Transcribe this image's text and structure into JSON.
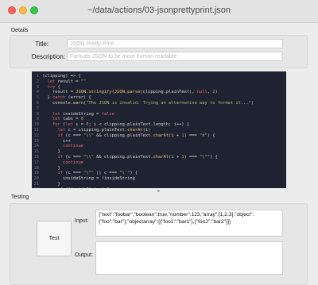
{
  "window": {
    "title": "~/data/actions/03-jsonprettyprint.json"
  },
  "details": {
    "section_label": "Details",
    "title_label": "Title:",
    "title_placeholder": "JSON Pretty Print",
    "description_label": "Description:",
    "description_placeholder": "Formats JSON to be more human readable"
  },
  "editor": {
    "lines": [
      {
        "num": "1",
        "parts": [
          [
            "txt",
            "(clipping) => {"
          ]
        ]
      },
      {
        "num": "2",
        "parts": [
          [
            "txt",
            "  "
          ],
          [
            "kw",
            "let"
          ],
          [
            "txt",
            " result = "
          ],
          [
            "str",
            "\"\""
          ]
        ]
      },
      {
        "num": "3",
        "parts": [
          [
            "txt",
            "  "
          ],
          [
            "kw",
            "try"
          ],
          [
            "txt",
            " {"
          ]
        ]
      },
      {
        "num": "4",
        "parts": [
          [
            "txt",
            "    result = "
          ],
          [
            "fn",
            "JSON"
          ],
          [
            "txt",
            "."
          ],
          [
            "fn",
            "stringify"
          ],
          [
            "txt",
            "("
          ],
          [
            "fn",
            "JSON"
          ],
          [
            "txt",
            "."
          ],
          [
            "fn",
            "parse"
          ],
          [
            "txt",
            "(clipping.plainText), "
          ],
          [
            "kw",
            "null"
          ],
          [
            "txt",
            ", "
          ],
          [
            "num",
            "2"
          ],
          [
            "txt",
            ")"
          ]
        ]
      },
      {
        "num": "5",
        "parts": [
          [
            "txt",
            "  } "
          ],
          [
            "kw",
            "catch"
          ],
          [
            "txt",
            " (error) {"
          ]
        ]
      },
      {
        "num": "6",
        "parts": [
          [
            "txt",
            "    console."
          ],
          [
            "fn",
            "warn"
          ],
          [
            "txt",
            "("
          ],
          [
            "str",
            "\"The JSON is invalid. Trying an alternative way to format it...\""
          ],
          [
            "txt",
            ")"
          ]
        ]
      },
      {
        "num": "7",
        "parts": [
          [
            "txt",
            ""
          ]
        ]
      },
      {
        "num": "8",
        "parts": [
          [
            "txt",
            "    "
          ],
          [
            "kw",
            "let"
          ],
          [
            "txt",
            " insideString = "
          ],
          [
            "kw",
            "false"
          ]
        ]
      },
      {
        "num": "9",
        "parts": [
          [
            "txt",
            "    "
          ],
          [
            "kw",
            "let"
          ],
          [
            "txt",
            " tabs = "
          ],
          [
            "num",
            "0"
          ]
        ]
      },
      {
        "num": "10",
        "parts": [
          [
            "txt",
            "    "
          ],
          [
            "kw",
            "for"
          ],
          [
            "txt",
            " ("
          ],
          [
            "kw",
            "let"
          ],
          [
            "txt",
            " i = "
          ],
          [
            "num",
            "0"
          ],
          [
            "txt",
            "; i < clipping.plainText.length; i++) {"
          ]
        ]
      },
      {
        "num": "11",
        "parts": [
          [
            "txt",
            "      "
          ],
          [
            "kw",
            "let"
          ],
          [
            "txt",
            " c = clipping.plainText."
          ],
          [
            "fn",
            "charAt"
          ],
          [
            "txt",
            "(i)"
          ]
        ]
      },
      {
        "num": "12",
        "parts": [
          [
            "txt",
            "      "
          ],
          [
            "kw",
            "if"
          ],
          [
            "txt",
            " (c === "
          ],
          [
            "str",
            "\"\\\\\""
          ],
          [
            "txt",
            " && clipping.plainText."
          ],
          [
            "fn",
            "charAt"
          ],
          [
            "txt",
            "(i + "
          ],
          [
            "num",
            "1"
          ],
          [
            "txt",
            ") === "
          ],
          [
            "str",
            "\"n\""
          ],
          [
            "txt",
            ") {"
          ]
        ]
      },
      {
        "num": "13",
        "parts": [
          [
            "txt",
            "        i++"
          ]
        ]
      },
      {
        "num": "14",
        "parts": [
          [
            "txt",
            "        "
          ],
          [
            "kw",
            "continue"
          ]
        ]
      },
      {
        "num": "15",
        "parts": [
          [
            "txt",
            "      }"
          ]
        ]
      },
      {
        "num": "16",
        "parts": [
          [
            "txt",
            "      "
          ],
          [
            "kw",
            "if"
          ],
          [
            "txt",
            " (c === "
          ],
          [
            "str",
            "\"\\\\\""
          ],
          [
            "txt",
            " && clipping.plainText."
          ],
          [
            "fn",
            "charAt"
          ],
          [
            "txt",
            "(i + "
          ],
          [
            "num",
            "1"
          ],
          [
            "txt",
            ") === "
          ],
          [
            "str",
            "\"\\\"\""
          ],
          [
            "txt",
            ") {"
          ]
        ]
      },
      {
        "num": "17",
        "parts": [
          [
            "txt",
            "        "
          ],
          [
            "kw",
            "continue"
          ]
        ]
      },
      {
        "num": "18",
        "parts": [
          [
            "txt",
            "      }"
          ]
        ]
      },
      {
        "num": "19",
        "parts": [
          [
            "txt",
            "      "
          ],
          [
            "kw",
            "if"
          ],
          [
            "txt",
            " (c === "
          ],
          [
            "str",
            "\"\\\"\""
          ],
          [
            "txt",
            " || c === "
          ],
          [
            "str",
            "\"\\'\""
          ],
          [
            "txt",
            ") {"
          ]
        ]
      },
      {
        "num": "20",
        "parts": [
          [
            "txt",
            "        insideString = !insideString"
          ]
        ]
      },
      {
        "num": "21",
        "parts": [
          [
            "txt",
            "      }"
          ]
        ]
      },
      {
        "num": "22",
        "parts": [
          [
            "txt",
            "      "
          ],
          [
            "kw",
            "if"
          ],
          [
            "txt",
            " (!insideString) {"
          ]
        ]
      },
      {
        "num": "23",
        "parts": [
          [
            "txt",
            "        "
          ],
          [
            "kw",
            "if"
          ],
          [
            "txt",
            " (c === "
          ],
          [
            "str",
            "\"[\""
          ],
          [
            "txt",
            " || c === "
          ],
          [
            "str",
            "\"{\""
          ],
          [
            "txt",
            ") {"
          ]
        ]
      },
      {
        "num": "24",
        "parts": [
          [
            "txt",
            "          result += "
          ],
          [
            "str",
            "\"\\n\""
          ]
        ]
      }
    ]
  },
  "testing": {
    "section_label": "Testing",
    "test_button": "Test",
    "input_label": "Input:",
    "input_value": "{\"text\":\"foobar\",\"boolean\":true,\"number\":123,\"array\":[1,2,3],\"object\":{\"foo\":\"bar\"},\"objectarray\":[{\"foo1\":\"bar1\"},{\"foo2\":\"bar2\"}]}",
    "output_label": "Output:",
    "output_value": ""
  }
}
